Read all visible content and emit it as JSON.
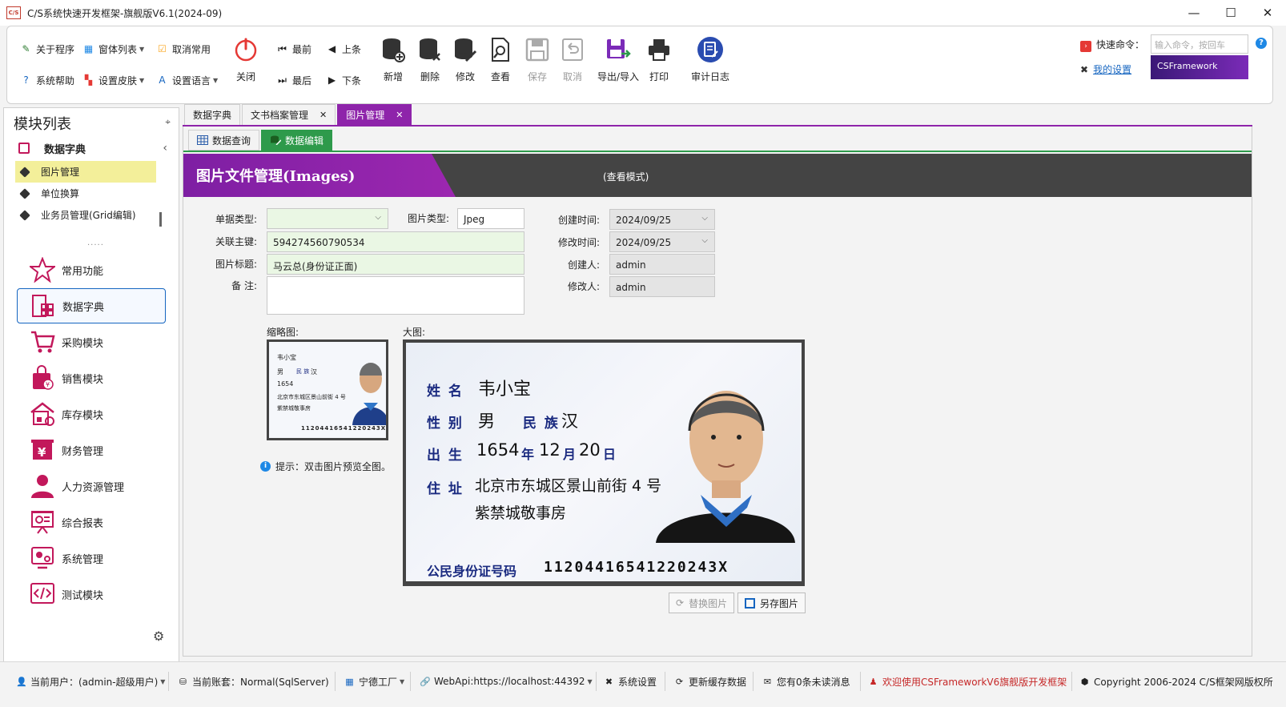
{
  "window": {
    "title": "C/S系统快速开发框架-旗舰版V6.1(2024-09)",
    "logo_text": "C/S",
    "minimize": "—",
    "maximize": "☐",
    "close": "✕"
  },
  "ribbon": {
    "small": {
      "about": "关于程序",
      "windows": "窗体列表",
      "unfavorite": "取消常用",
      "help": "系统帮助",
      "skin": "设置皮肤",
      "language": "设置语言",
      "first": "最前",
      "prev": "上条",
      "last": "最后",
      "next": "下条"
    },
    "big": {
      "close": "关闭",
      "add": "新增",
      "delete": "删除",
      "edit": "修改",
      "view": "查看",
      "save": "保存",
      "cancel": "取消",
      "export": "导出/导入",
      "print": "打印",
      "audit": "审计日志"
    },
    "quick_command_label": "快速命令：",
    "quick_command_placeholder": "输入命令，按回车",
    "my_settings": "我的设置",
    "banner": "CSFramework"
  },
  "left_panel": {
    "title": "模块列表",
    "group": "数据字典",
    "items": [
      {
        "label": "图片管理",
        "selected": true
      },
      {
        "label": "单位换算",
        "selected": false
      },
      {
        "label": "业务员管理(Grid编辑)",
        "selected": false
      }
    ],
    "grip": "·····",
    "modules": [
      {
        "label": "常用功能",
        "icon": "star-icon"
      },
      {
        "label": "数据字典",
        "icon": "dictionary-icon",
        "active": true
      },
      {
        "label": "采购模块",
        "icon": "cart-icon"
      },
      {
        "label": "销售模块",
        "icon": "shopping-bag-icon"
      },
      {
        "label": "库存模块",
        "icon": "warehouse-icon"
      },
      {
        "label": "财务管理",
        "icon": "finance-icon"
      },
      {
        "label": "人力资源管理",
        "icon": "person-icon"
      },
      {
        "label": "综合报表",
        "icon": "report-icon"
      },
      {
        "label": "系统管理",
        "icon": "system-icon"
      },
      {
        "label": "测试模块",
        "icon": "code-icon"
      }
    ]
  },
  "doc_tabs": [
    {
      "label": "数据字典",
      "closable": false
    },
    {
      "label": "文书档案管理",
      "closable": true
    },
    {
      "label": "图片管理",
      "closable": true,
      "active": true
    }
  ],
  "sub_tabs": [
    {
      "label": "数据查询"
    },
    {
      "label": "数据编辑",
      "active": true
    }
  ],
  "header": {
    "title": "图片文件管理(Images)",
    "mode": "(查看模式)"
  },
  "form": {
    "doc_type_label": "单据类型:",
    "doc_type_value": "",
    "image_type_label": "图片类型:",
    "image_type_value": "Jpeg",
    "key_label": "关联主键:",
    "key_value": "594274560790534",
    "title_label": "图片标题:",
    "title_value": "马云总(身份证正面)",
    "note_label": "备  注:",
    "note_value": "",
    "created_time_label": "创建时间:",
    "created_time_value": "2024/09/25",
    "modified_time_label": "修改时间:",
    "modified_time_value": "2024/09/25",
    "creator_label": "创建人:",
    "creator_value": "admin",
    "modifier_label": "修改人:",
    "modifier_value": "admin"
  },
  "images": {
    "thumb_label": "缩略图:",
    "big_label": "大图:",
    "hint": "提示：双击图片预览全图。",
    "replace_button": "替换图片",
    "saveas_button": "另存图片",
    "id_card": {
      "name_label": "姓 名",
      "name": "韦小宝",
      "gender_label": "性 别",
      "gender": "男",
      "ethnic_label": "民 族",
      "ethnic": "汉",
      "birth_label": "出 生",
      "birth_year": "1654",
      "year_char": "年",
      "birth_month": "12",
      "month_char": "月",
      "birth_day": "20",
      "day_char": "日",
      "address_label": "住 址",
      "address_line1": "北京市东城区景山前街 4 号",
      "address_line2": "紫禁城敬事房",
      "id_label": "公民身份证号码",
      "id_number": "11204416541220243X"
    }
  },
  "statusbar": {
    "user": "当前用户：(admin-超级用户)",
    "account": "当前账套：Normal(SqlServer)",
    "factory": "宁德工厂",
    "webapi": "WebApi:https://localhost:44392",
    "settings": "系统设置",
    "refresh": "更新缓存数据",
    "messages": "您有0条未读消息",
    "welcome": "欢迎使用CSFrameworkV6旗舰版开发框架",
    "copyright": "Copyright 2006-2024 C/S框架网版权所"
  },
  "colors": {
    "accent": "#8e24aa",
    "green": "#2e9a4b",
    "selection": "#f3ef9a",
    "link": "#1565c0"
  }
}
